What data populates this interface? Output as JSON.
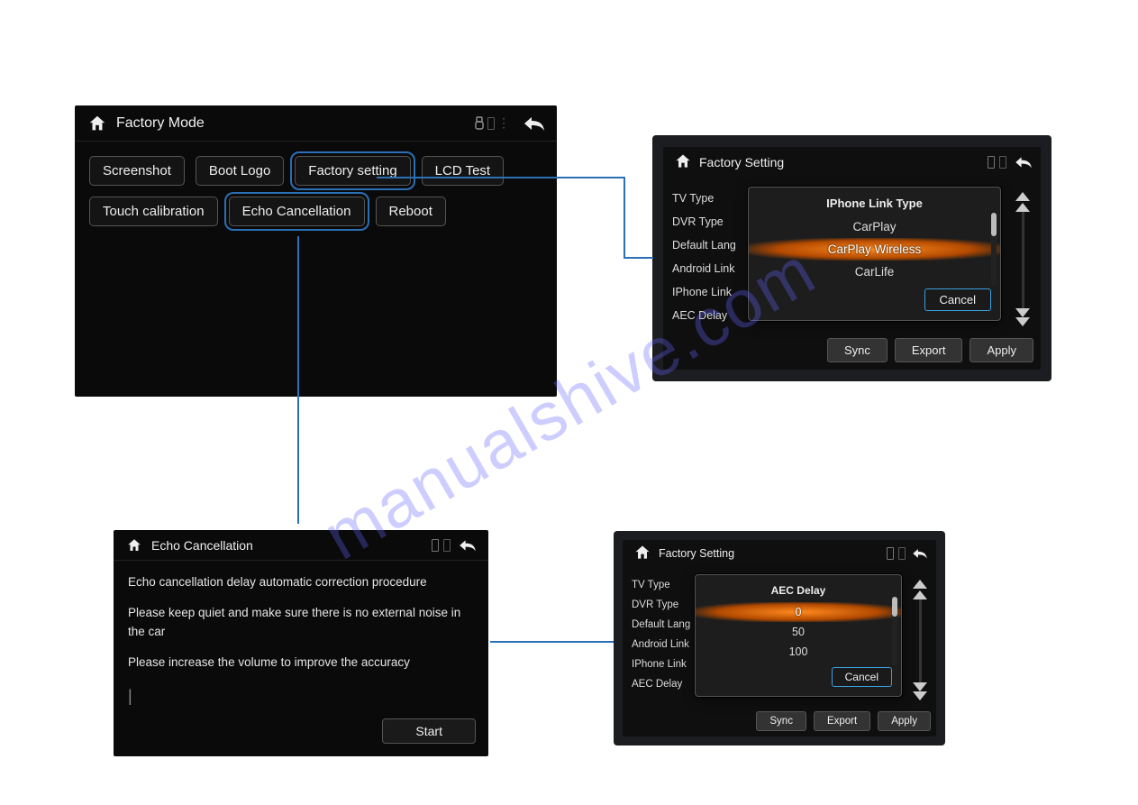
{
  "watermark": "manualshive.com",
  "panelA": {
    "title": "Factory Mode",
    "buttons": [
      "Screenshot",
      "Boot Logo",
      "Factory setting",
      "LCD Test",
      "Touch calibration",
      "Echo Cancellation",
      "Reboot"
    ],
    "highlighted": [
      "Factory setting",
      "Echo Cancellation"
    ]
  },
  "panelB": {
    "title": "Factory Setting",
    "sideLabels": [
      "TV Type",
      "DVR Type",
      "Default Lang",
      "Android Link",
      "IPhone Link",
      "AEC Delay"
    ],
    "popupTitle": "IPhone Link Type",
    "options": [
      "CarPlay",
      "CarPlay Wireless",
      "CarLife"
    ],
    "selected": "CarPlay Wireless",
    "cancel": "Cancel",
    "bottom": [
      "Sync",
      "Export",
      "Apply"
    ]
  },
  "panelC": {
    "title": "Echo Cancellation",
    "lines": [
      "Echo cancellation delay automatic correction procedure",
      "Please keep quiet and make sure there is no external noise in the car",
      "Please increase the volume to improve the accuracy"
    ],
    "start": "Start"
  },
  "panelD": {
    "title": "Factory Setting",
    "sideLabels": [
      "TV Type",
      "DVR Type",
      "Default Lang",
      "Android Link",
      "IPhone Link",
      "AEC Delay"
    ],
    "popupTitle": "AEC Delay",
    "options": [
      "0",
      "50",
      "100"
    ],
    "selected": "0",
    "cancel": "Cancel",
    "bottom": [
      "Sync",
      "Export",
      "Apply"
    ]
  }
}
